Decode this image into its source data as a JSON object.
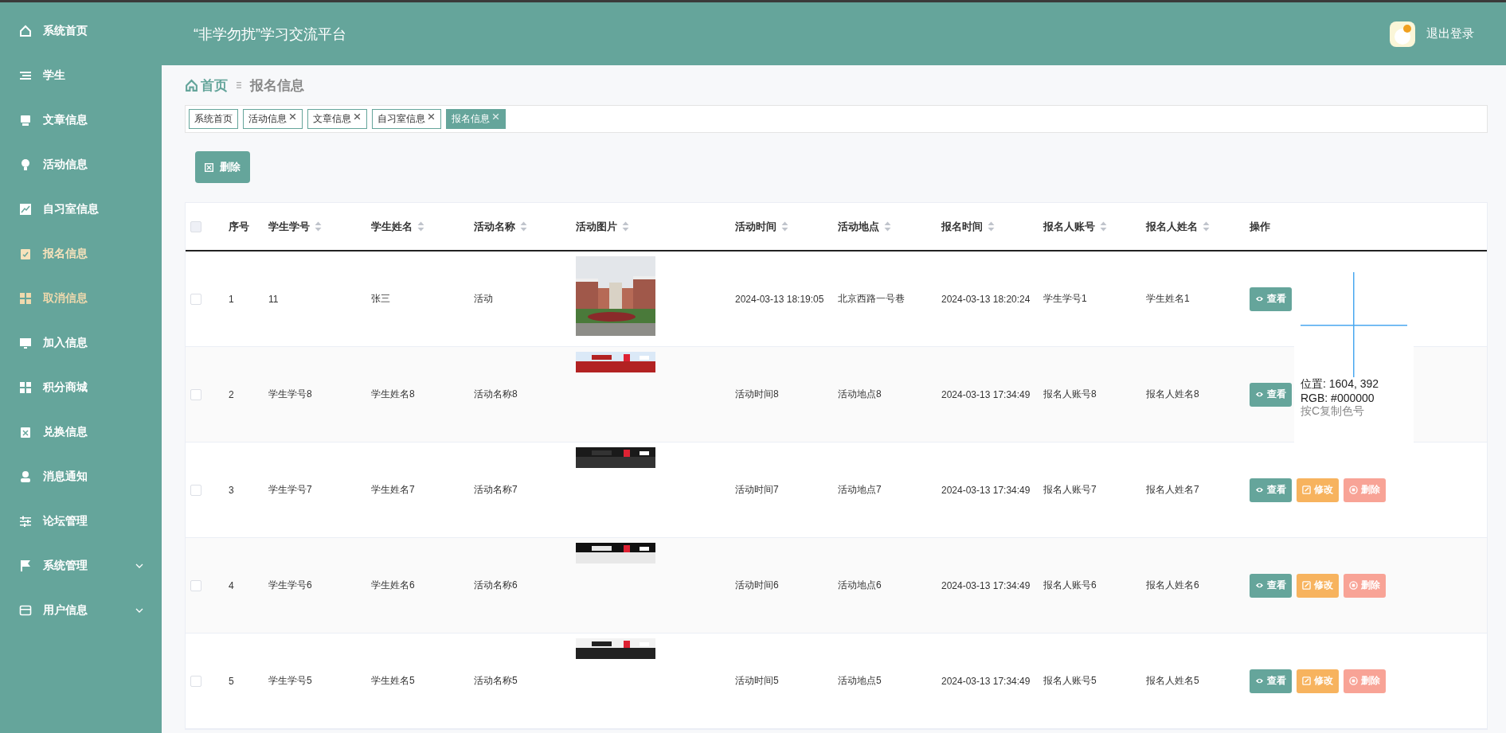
{
  "header": {
    "title": "“非学勿扰”学习交流平台",
    "logout": "退出登录"
  },
  "sidebar": {
    "items": [
      {
        "label": "系统首页",
        "kind": "link",
        "selected": false,
        "hover": false
      },
      {
        "label": "学生",
        "kind": "link",
        "selected": false,
        "hover": false
      },
      {
        "label": "文章信息",
        "kind": "link",
        "selected": false,
        "hover": false
      },
      {
        "label": "活动信息",
        "kind": "link",
        "selected": false,
        "hover": false
      },
      {
        "label": "自习室信息",
        "kind": "link",
        "selected": false,
        "hover": false
      },
      {
        "label": "报名信息",
        "kind": "link",
        "selected": true,
        "hover": false
      },
      {
        "label": "取消信息",
        "kind": "link",
        "selected": false,
        "hover": true
      },
      {
        "label": "加入信息",
        "kind": "link",
        "selected": false,
        "hover": false
      },
      {
        "label": "积分商城",
        "kind": "link",
        "selected": false,
        "hover": false
      },
      {
        "label": "兑换信息",
        "kind": "link",
        "selected": false,
        "hover": false
      },
      {
        "label": "消息通知",
        "kind": "link",
        "selected": false,
        "hover": false
      },
      {
        "label": "论坛管理",
        "kind": "link",
        "selected": false,
        "hover": false
      },
      {
        "label": "系统管理",
        "kind": "menu",
        "selected": false,
        "hover": false,
        "expanded": false
      },
      {
        "label": "用户信息",
        "kind": "menu",
        "selected": false,
        "hover": false,
        "expanded": false
      }
    ]
  },
  "breadcrumb": {
    "home": "首页",
    "current": "报名信息"
  },
  "tags": [
    {
      "label": "系统首页",
      "closable": false,
      "selected": false
    },
    {
      "label": "活动信息",
      "closable": true,
      "selected": false
    },
    {
      "label": "文章信息",
      "closable": true,
      "selected": false
    },
    {
      "label": "自习室信息",
      "closable": true,
      "selected": false
    },
    {
      "label": "报名信息",
      "closable": true,
      "selected": true
    }
  ],
  "toolbar": {
    "delete_button": "删除"
  },
  "table": {
    "columns": [
      {
        "label": "序号",
        "sortable": false
      },
      {
        "label": "学生学号",
        "sortable": true
      },
      {
        "label": "学生姓名",
        "sortable": true
      },
      {
        "label": "活动名称",
        "sortable": true
      },
      {
        "label": "活动图片",
        "sortable": true
      },
      {
        "label": "活动时间",
        "sortable": true
      },
      {
        "label": "活动地点",
        "sortable": true
      },
      {
        "label": "报名时间",
        "sortable": true
      },
      {
        "label": "报名人账号",
        "sortable": true
      },
      {
        "label": "报名人姓名",
        "sortable": true
      },
      {
        "label": "操作",
        "sortable": false
      }
    ],
    "header_checked": false,
    "rows": [
      {
        "checked": false,
        "cells": [
          "1",
          "11",
          "张三",
          "活动"
        ],
        "picture": {
          "kind": "picture",
          "loaded": true
        },
        "cells_after": [
          "2024-03-13 18:19:05",
          "北京西路一号巷",
          "2024-03-13 18:20:24",
          "学生学号1",
          "学生姓名1"
        ],
        "actions": [
          {
            "kind": "view",
            "label": "查看"
          }
        ]
      },
      {
        "checked": false,
        "cells": [
          "2",
          "学生学号8",
          "学生姓名8",
          "活动名称8"
        ],
        "picture": {
          "kind": "picture",
          "loaded": false
        },
        "cells_after": [
          "活动时间8",
          "活动地点8",
          "2024-03-13 17:34:49",
          "报名人账号8",
          "报名人姓名8"
        ],
        "actions": [
          {
            "kind": "view",
            "label": "查看"
          }
        ]
      },
      {
        "checked": false,
        "cells": [
          "3",
          "学生学号7",
          "学生姓名7",
          "活动名称7"
        ],
        "picture": {
          "kind": "picture",
          "loaded": false
        },
        "cells_after": [
          "活动时间7",
          "活动地点7",
          "2024-03-13 17:34:49",
          "报名人账号7",
          "报名人姓名7"
        ],
        "actions": [
          {
            "kind": "view",
            "label": "查看"
          },
          {
            "kind": "edit",
            "label": "修改"
          },
          {
            "kind": "delete",
            "label": "删除"
          }
        ]
      },
      {
        "checked": false,
        "cells": [
          "4",
          "学生学号6",
          "学生姓名6",
          "活动名称6"
        ],
        "picture": {
          "kind": "picture",
          "loaded": false
        },
        "cells_after": [
          "活动时间6",
          "活动地点6",
          "2024-03-13 17:34:49",
          "报名人账号6",
          "报名人姓名6"
        ],
        "actions": [
          {
            "kind": "view",
            "label": "查看"
          },
          {
            "kind": "edit",
            "label": "修改"
          },
          {
            "kind": "delete",
            "label": "删除"
          }
        ]
      },
      {
        "checked": false,
        "cells": [
          "5",
          "学生学号5",
          "学生姓名5",
          "活动名称5"
        ],
        "picture": {
          "kind": "picture",
          "loaded": false
        },
        "cells_after": [
          "活动时间5",
          "活动地点5",
          "2024-03-13 17:34:49",
          "报名人账号5",
          "报名人姓名5"
        ],
        "actions": [
          {
            "kind": "view",
            "label": "查看"
          },
          {
            "kind": "edit",
            "label": "修改"
          },
          {
            "kind": "delete",
            "label": "删除"
          }
        ]
      }
    ]
  },
  "color_picker": {
    "position": "位置: 1604, 392",
    "rgb": "RGB: #000000",
    "hint": "按C复制色号"
  }
}
